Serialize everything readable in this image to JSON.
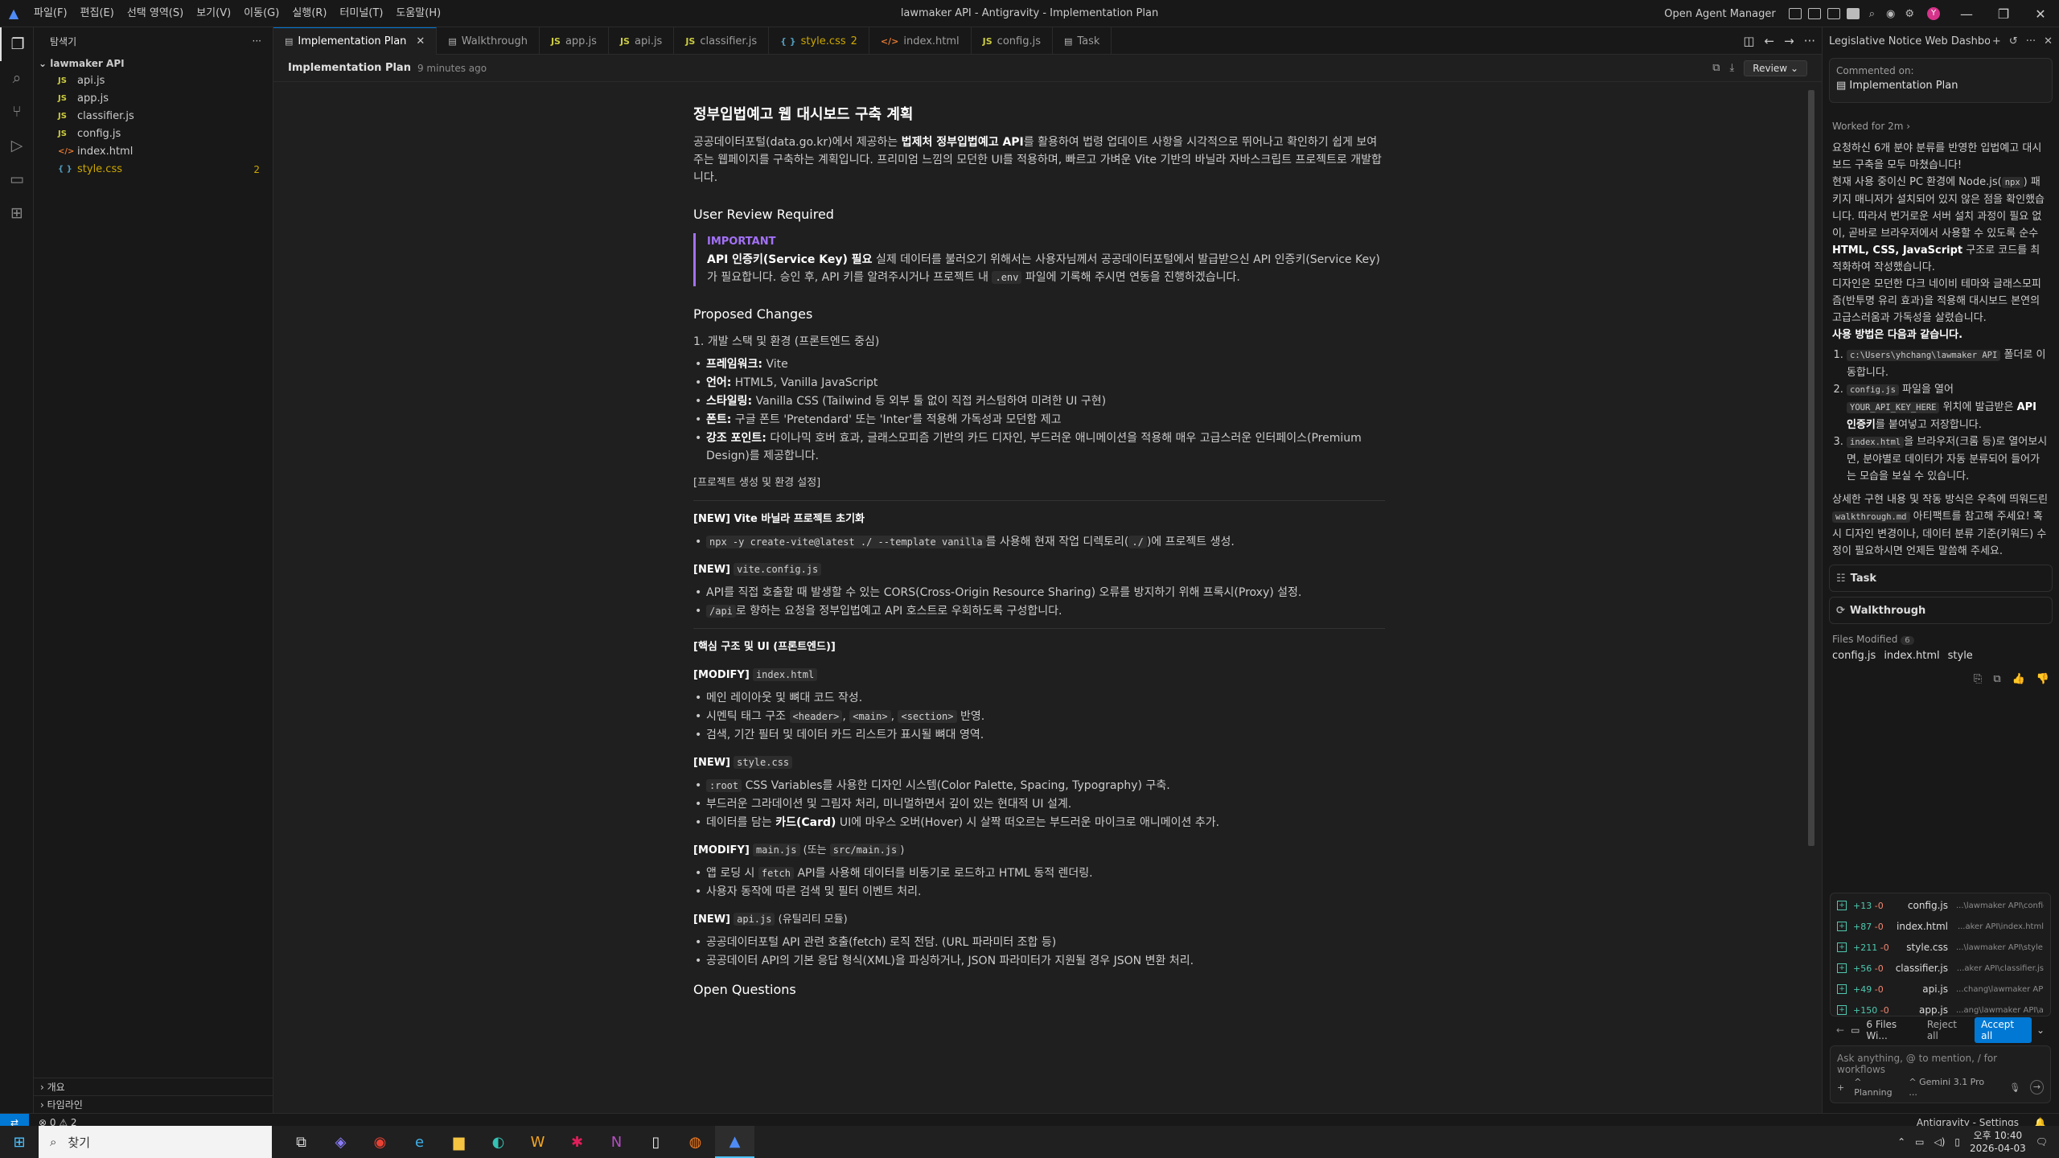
{
  "titlebar": {
    "menu": [
      "파일(F)",
      "편집(E)",
      "선택 영역(S)",
      "보기(V)",
      "이동(G)",
      "실행(R)",
      "터미널(T)",
      "도움말(H)"
    ],
    "window_title": "lawmaker API - Antigravity - Implementation Plan",
    "open_agent_manager": "Open Agent Manager"
  },
  "explorer": {
    "title": "탐색기",
    "project": "lawmaker API",
    "files": [
      {
        "name": "api.js",
        "icon": "JS"
      },
      {
        "name": "app.js",
        "icon": "JS"
      },
      {
        "name": "classifier.js",
        "icon": "JS"
      },
      {
        "name": "config.js",
        "icon": "JS"
      },
      {
        "name": "index.html",
        "icon": "</>"
      },
      {
        "name": "style.css",
        "icon": "{ }",
        "count": "2"
      }
    ],
    "outline": "개요",
    "timeline": "타임라인"
  },
  "tabs": [
    {
      "label": "Implementation Plan",
      "icon": "doc",
      "active": true
    },
    {
      "label": "Walkthrough",
      "icon": "doc"
    },
    {
      "label": "app.js",
      "icon": "JS"
    },
    {
      "label": "api.js",
      "icon": "JS"
    },
    {
      "label": "classifier.js",
      "icon": "JS"
    },
    {
      "label": "style.css",
      "icon": "{ }",
      "badge": "2"
    },
    {
      "label": "index.html",
      "icon": "</>"
    },
    {
      "label": "config.js",
      "icon": "JS"
    },
    {
      "label": "Task",
      "icon": "doc"
    }
  ],
  "docbar": {
    "title": "Implementation Plan",
    "ago": "9 minutes ago",
    "review": "Review"
  },
  "doc": {
    "h1": "정부입법예고 웹 대시보드 구축 계획",
    "intro_a": "공공데이터포털(data.go.kr)에서 제공하는 ",
    "intro_b": "법제처 정부입법예고 API",
    "intro_c": "를 활용하여 법령 업데이트 사항을 시각적으로 뛰어나고 확인하기 쉽게 보여주는 웹페이지를 구축하는 계획입니다. 프리미엄 느낌의 모던한 UI를 적용하며, 빠르고 가벼운 Vite 기반의 바닐라 자바스크립트 프로젝트로 개발합니다.",
    "review_h": "User Review Required",
    "important": "IMPORTANT",
    "imp_b": "API 인증키(Service Key) 필요",
    "imp_t1": " 실제 데이터를 불러오기 위해서는 사용자님께서 공공데이터포털에서 발급받으신 API 인증키(Service Key)가 필요합니다. 승인 후, API 키를 알려주시거나 프로젝트 내 ",
    "imp_code": ".env",
    "imp_t2": " 파일에 기록해 주시면 연동을 진행하겠습니다.",
    "changes_h": "Proposed Changes",
    "sec1": "1. 개발 스택 및 환경 (프론트엔드 중심)",
    "stack": [
      {
        "k": "프레임워크:",
        "v": " Vite"
      },
      {
        "k": "언어:",
        "v": " HTML5, Vanilla JavaScript"
      },
      {
        "k": "스타일링:",
        "v": " Vanilla CSS (Tailwind 등 외부 툴 없이 직접 커스텀하여 미려한 UI 구현)"
      },
      {
        "k": "폰트:",
        "v": " 구글 폰트 'Pretendard' 또는 'Inter'를 적용해 가독성과 모던함 제고"
      },
      {
        "k": "강조 포인트:",
        "v": " 다이나믹 호버 효과, 글래스모피즘 기반의 카드 디자인, 부드러운 애니메이션을 적용해 매우 고급스러운 인터페이스(Premium Design)를 제공합니다."
      }
    ],
    "setup_h": "[프로젝트 생성 및 환경 설정]",
    "new_vite": "[NEW] Vite 바닐라 프로젝트 초기화",
    "vite_cmd": "npx -y create-vite@latest ./ --template vanilla",
    "vite_t1": "를 사용해 현재 작업 디렉토리(",
    "vite_code2": "./",
    "vite_t2": ")에 프로젝트 생성.",
    "new_viteconfig": "[NEW]",
    "viteconfig_code": "vite.config.js",
    "vc1": "API를 직접 호출할 때 발생할 수 있는 CORS(Cross-Origin Resource Sharing) 오류를 방지하기 위해 프록시(Proxy) 설정.",
    "vc2_code": "/api",
    "vc2": "로 향하는 요청을 정부입법예고 API 호스트로 우회하도록 구성합니다.",
    "core_h": "[핵심 구조 및 UI (프론트엔드)]",
    "mod_index": "[MODIFY]",
    "index_code": "index.html",
    "idx1": "메인 레이아웃 및 뼈대 코드 작성.",
    "idx2a": "시멘틱 태그 구조 ",
    "idx2_c1": "<header>",
    "idx2_c2": "<main>",
    "idx2_c3": "<section>",
    "idx2b": " 반영.",
    "idx3": "검색, 기간 필터 및 데이터 카드 리스트가 표시될 뼈대 영역.",
    "new_style": "[NEW]",
    "style_code": "style.css",
    "st1_code": ":root",
    "st1": " CSS Variables를 사용한 디자인 시스템(Color Palette, Spacing, Typography) 구축.",
    "st2": "부드러운 그라데이션 및 그림자 처리, 미니멀하면서 깊이 있는 현대적 UI 설계.",
    "st3a": "데이터를 담는 ",
    "st3b": "카드(Card)",
    "st3c": " UI에 마우스 오버(Hover) 시 살짝 떠오르는 부드러운 마이크로 애니메이션 추가.",
    "mod_main": "[MODIFY]",
    "main_code": "main.js",
    "main_or": " (또는 ",
    "main_code2": "src/main.js",
    "main_close": ")",
    "mn1a": "앱 로딩 시 ",
    "mn1_code": "fetch",
    "mn1b": " API를 사용해 데이터를 비동기로 로드하고 HTML 동적 렌더링.",
    "mn2": "사용자 동작에 따른 검색 및 필터 이벤트 처리.",
    "new_api": "[NEW]",
    "api_code": "api.js",
    "api_util": " (유틸리티 모듈)",
    "ap1": "공공데이터포털 API 관련 호출(fetch) 로직 전담. (URL 파라미터 조합 등)",
    "ap2": "공공데이터 API의 기본 응답 형식(XML)을 파싱하거나, JSON 파라미터가 지원될 경우 JSON 변환 처리.",
    "open_q": "Open Questions"
  },
  "panel": {
    "title": "Legislative Notice Web Dashbo",
    "commented_on": "Commented on:",
    "commented_doc": "Implementation Plan",
    "worked_for": "Worked for 2m",
    "p1": "요청하신 6개 분야 분류를 반영한 입법예고 대시보드 구축을 모두 마쳤습니다!",
    "p2a": "현재 사용 중이신 PC 환경에 Node.js(",
    "p2_code": "npx",
    "p2b": ") 패키지 매니저가 설치되어 있지 않은 점을 확인했습니다. 따라서 번거로운 서버 설치 과정이 필요 없이, 곧바로 브라우저에서 사용할 수 있도록 순수 ",
    "p2_bold": "HTML, CSS, JavaScript",
    "p2c": " 구조로 코드를 최적화하여 작성했습니다.",
    "p3": "디자인은 모던한 다크 네이비 테마와 글래스모피즘(반투명 유리 효과)을 적용해 대시보드 본연의 고급스러움과 가독성을 살렸습니다.",
    "usage": "사용 방법은 다음과 같습니다.",
    "s1_code": "c:\\Users\\yhchang\\lawmaker API",
    "s1": " 폴더로 이동합니다.",
    "s2_code": "config.js",
    "s2a": " 파일을 열어 ",
    "s2_code2": "YOUR_API_KEY_HERE",
    "s2b": " 위치에 발급받은 ",
    "s2_bold": "API 인증키",
    "s2c": "를 붙여넣고 저장합니다.",
    "s3_code": "index.html",
    "s3": "을 브라우저(크롬 등)로 열어보시면, 분야별로 데이터가 자동 분류되어 들어가는 모습을 보실 수 있습니다.",
    "p4a": "상세한 구현 내용 및 작동 방식은 우측에 띄워드린 ",
    "p4_code": "walkthrough.md",
    "p4b": " 아티팩트를 참고해 주세요! 혹시 디자인 변경이나, 데이터 분류 기준(키워드) 수정이 필요하시면 언제든 말씀해 주세요.",
    "task": "Task",
    "walkthrough": "Walkthrough",
    "files_modified": "Files Modified",
    "files_modified_count": "6",
    "fm_files": [
      "config.js",
      "index.html",
      "style"
    ],
    "changes": [
      {
        "plus": "+13",
        "minus": "-0",
        "name": "config.js",
        "path": "...\\lawmaker API\\config.js"
      },
      {
        "plus": "+87",
        "minus": "-0",
        "name": "index.html",
        "path": "...aker API\\index.html"
      },
      {
        "plus": "+211",
        "minus": "-0",
        "name": "style.css",
        "path": "...\\lawmaker API\\style.css"
      },
      {
        "plus": "+56",
        "minus": "-0",
        "name": "classifier.js",
        "path": "...aker API\\classifier.js"
      },
      {
        "plus": "+49",
        "minus": "-0",
        "name": "api.js",
        "path": "...chang\\lawmaker API\\api.js"
      },
      {
        "plus": "+150",
        "minus": "-0",
        "name": "app.js",
        "path": "...ang\\lawmaker API\\app.js"
      }
    ],
    "files_summary": "6 Files Wi...",
    "reject_all": "Reject all",
    "accept_all": "Accept all",
    "ask_placeholder": "Ask anything, @ to mention, / for workflows",
    "planning": "Planning",
    "model": "Gemini 3.1 Pro ..."
  },
  "status": {
    "problems": "0",
    "warnings": "2",
    "settings": "Antigravity - Settings"
  },
  "taskbar": {
    "search": "찾기",
    "ampm": "오후 10:40",
    "date": "2026-04-03"
  }
}
